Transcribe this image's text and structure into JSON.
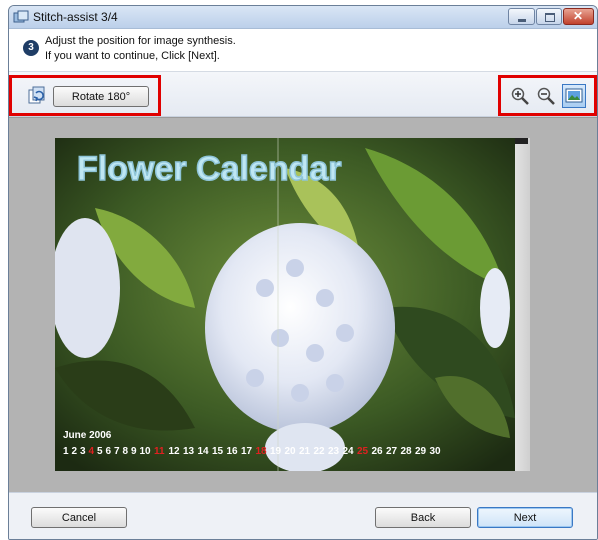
{
  "window": {
    "title": "Stitch-assist 3/4",
    "controls": [
      "minimize-icon",
      "maximize-icon",
      "close-icon"
    ]
  },
  "instructions": {
    "step_number": "3",
    "line1": "Adjust the position for image synthesis.",
    "line2": "If you want to continue, Click [Next]."
  },
  "toolbar": {
    "rotate_label": "Rotate 180°",
    "icons": [
      "rotate-icon",
      "zoom-in-icon",
      "zoom-out-icon",
      "fit-to-window-icon"
    ],
    "highlight_color": "#e00000"
  },
  "preview": {
    "calendar_title": "Flower Calendar",
    "calendar_month": "June 2006",
    "days": [
      "1",
      "2",
      "3",
      "4",
      "5",
      "6",
      "7",
      "8",
      "9",
      "10",
      "11",
      "12",
      "13",
      "14",
      "15",
      "16",
      "17",
      "18",
      "19",
      "20",
      "21",
      "22",
      "23",
      "24",
      "25",
      "26",
      "27",
      "28",
      "29",
      "30"
    ],
    "red_days": [
      "4",
      "11",
      "18",
      "25"
    ]
  },
  "footer": {
    "cancel_label": "Cancel",
    "back_label": "Back",
    "next_label": "Next"
  }
}
